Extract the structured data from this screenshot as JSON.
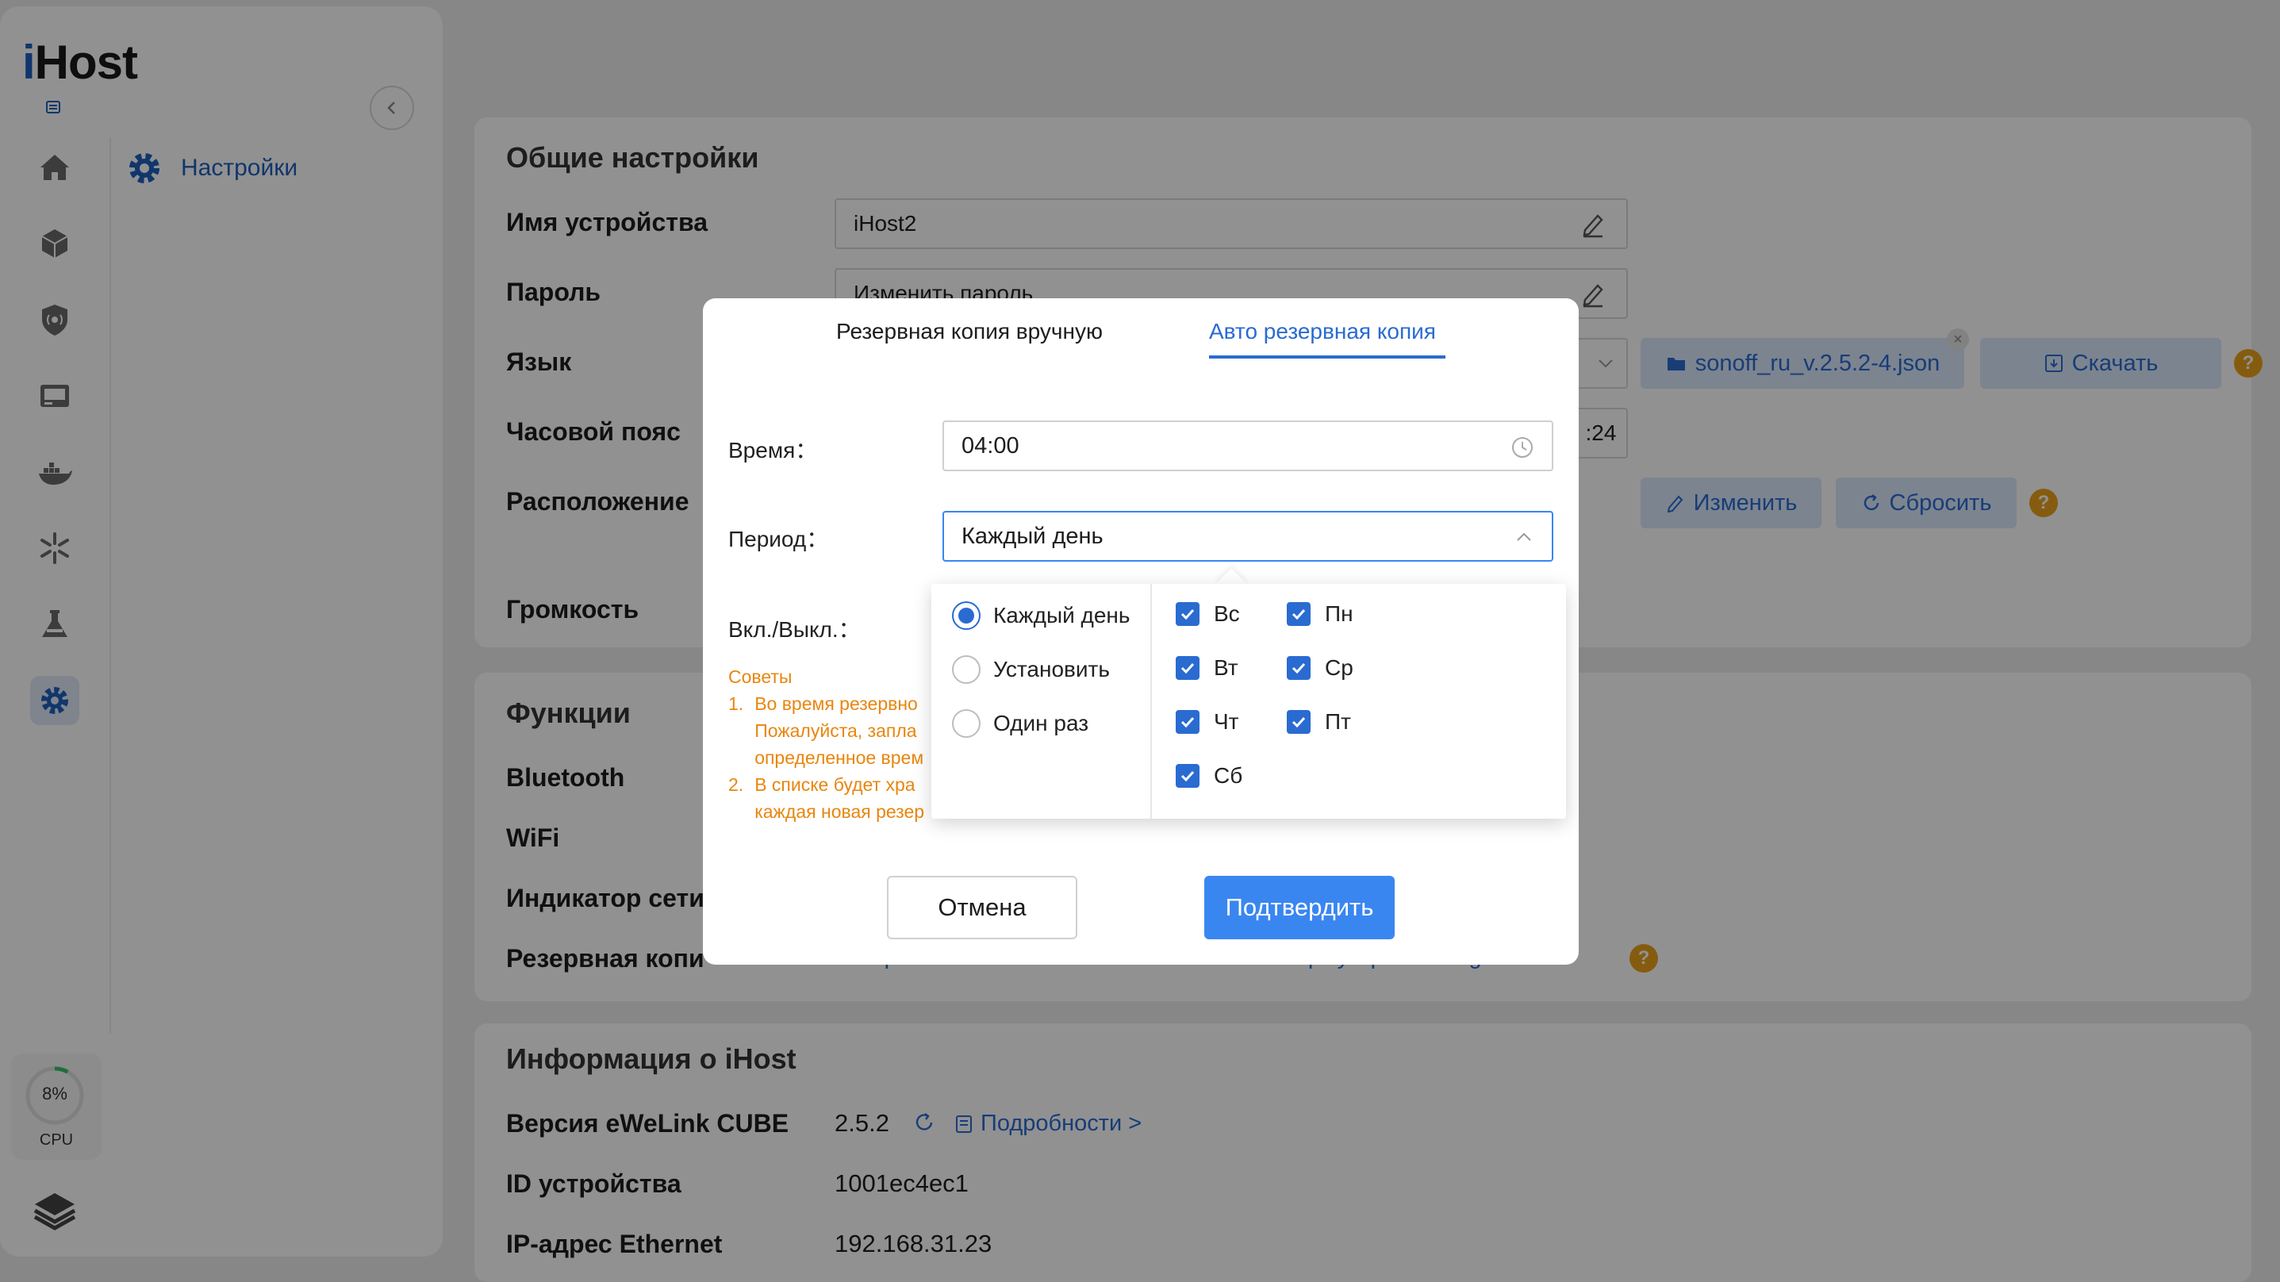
{
  "app": {
    "logo_prefix": "i",
    "logo_rest": "Host"
  },
  "sidebar": {
    "submenu_label": "Настройки",
    "cpu_percent": "8%",
    "cpu_label": "CPU",
    "cpu_value": 0.08,
    "nav_items": [
      "home-icon",
      "device-cube-icon",
      "security-shield-icon",
      "screen-icon",
      "docker-icon",
      "automation-icon",
      "lab-flask-icon",
      "settings-gear-icon"
    ]
  },
  "general": {
    "title": "Общие настройки",
    "device_name_label": "Имя устройства",
    "device_name_value": "iHost2",
    "password_label": "Пароль",
    "password_value": "Изменить пароль",
    "language_label": "Язык",
    "language_file": "sonoff_ru_v.2.5.2-4.json",
    "download_label": "Скачать",
    "timezone_label": "Часовой пояс",
    "timezone_value_tail": ":24",
    "location_label": "Расположение",
    "edit_label": "Изменить",
    "reset_label": "Сбросить",
    "volume_label": "Громкость"
  },
  "functions": {
    "title": "Функции",
    "bluetooth": "Bluetooth",
    "wifi": "WiFi",
    "net_indicator": "Индикатор сети",
    "backup_label": "Резервная копи",
    "backup_link": "Резервная копия",
    "restore_link": "Восстановление",
    "export_link": "Экспорт устройств Zigbee"
  },
  "info": {
    "title": "Информация о iHost",
    "version_label": "Версия eWeLink CUBE",
    "version_value": "2.5.2",
    "details_link": "Подробности >",
    "device_id_label": "ID устройства",
    "device_id_value": "1001ec4ec1",
    "ip_label": "IP-адрес Ethernet",
    "ip_value": "192.168.31.23"
  },
  "modal": {
    "tab_manual": "Резервная копия вручную",
    "tab_auto": "Авто резервная копия",
    "time_label": "Время：",
    "time_value": "04:00",
    "period_label": "Период：",
    "period_value": "Каждый день",
    "onoff_label": "Вкл./Выкл.：",
    "tips_title": "Советы",
    "tip1_num": "1.",
    "tip1_line1": "Во время резервно",
    "tip1_line2": "Пожалуйста, запла",
    "tip1_line3": "определенное врем",
    "tip2_num": "2.",
    "tip2_line1": "В списке будет хра",
    "tip2_line2": "каждая новая резер",
    "cancel": "Отмена",
    "confirm": "Подтвердить"
  },
  "period_dropdown": {
    "options": [
      {
        "label": "Каждый день",
        "selected": true
      },
      {
        "label": "Установить",
        "selected": false
      },
      {
        "label": "Один раз",
        "selected": false
      }
    ],
    "days": [
      {
        "label": "Вс",
        "checked": true
      },
      {
        "label": "Пн",
        "checked": true
      },
      {
        "label": "Вт",
        "checked": true
      },
      {
        "label": "Ср",
        "checked": true
      },
      {
        "label": "Чт",
        "checked": true
      },
      {
        "label": "Пт",
        "checked": true
      },
      {
        "label": "Сб",
        "checked": true
      }
    ]
  },
  "colors": {
    "accent": "#2a6bd1",
    "warning": "#e8860e",
    "help": "#eaa31b",
    "primary_button": "#3a86f0"
  }
}
